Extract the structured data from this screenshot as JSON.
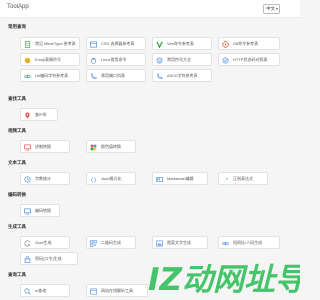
{
  "header": {
    "brand": "ToolApp",
    "language": "中文"
  },
  "watermark": "IZ动网址导航",
  "accent": "#4a90e2",
  "sections": [
    {
      "title": "常用查询",
      "items": [
        {
          "label": "常见 MimeType 参考表",
          "icon": "doc-icon"
        },
        {
          "label": "CSS 选择器参考表",
          "icon": "css-icon"
        },
        {
          "label": "Vim命令参考表",
          "icon": "vim-icon"
        },
        {
          "label": "Git命令参考表",
          "icon": "git-icon"
        },
        {
          "label": "Emoji表情符号",
          "icon": "emoji-icon"
        },
        {
          "label": "Linux常用命令",
          "icon": "linux-icon"
        },
        {
          "label": "常用符号大全",
          "icon": "symbol-icon"
        },
        {
          "label": "HTTP状态码对照表",
          "icon": "http-icon"
        },
        {
          "label": "Url编码字符参考表",
          "icon": "link-icon"
        },
        {
          "label": "常用端口列表",
          "icon": "port-icon"
        },
        {
          "label": "ASCII字符参考表",
          "icon": "ascii-icon"
        }
      ]
    },
    {
      "title": "查找工具",
      "items": [
        {
          "label": "查IP所",
          "icon": "location-icon"
        }
      ]
    },
    {
      "title": "视频工具",
      "items": [
        {
          "label": "进制转换",
          "icon": "monitor-icon"
        },
        {
          "label": "颜色值转换",
          "icon": "palette-icon"
        }
      ]
    },
    {
      "title": "文本工具",
      "items": [
        {
          "label": "字数统计",
          "icon": "count-icon"
        },
        {
          "label": "Json格式化",
          "icon": "json-icon"
        },
        {
          "label": "Markdown编辑",
          "icon": "markdown-icon"
        },
        {
          "label": "正则表达式",
          "icon": "regex-icon"
        }
      ]
    },
    {
      "title": "编码转换",
      "items": [
        {
          "label": "编码转换",
          "icon": "encode-icon"
        }
      ]
    },
    {
      "title": "生成工具",
      "items": [
        {
          "label": "Guid生成",
          "icon": "guid-icon"
        },
        {
          "label": "二维码生成",
          "icon": "qrcode-icon"
        },
        {
          "label": "图案文字生成",
          "icon": "art-icon"
        },
        {
          "label": "短网址/人码生成",
          "icon": "shorturl-icon"
        },
        {
          "label": "密码(口令)生成",
          "icon": "password-icon"
        }
      ]
    },
    {
      "title": "查询工具",
      "items": [
        {
          "label": "ui查询",
          "icon": "search-icon"
        },
        {
          "label": "网站在线解析工具",
          "icon": "web-icon"
        }
      ]
    }
  ]
}
